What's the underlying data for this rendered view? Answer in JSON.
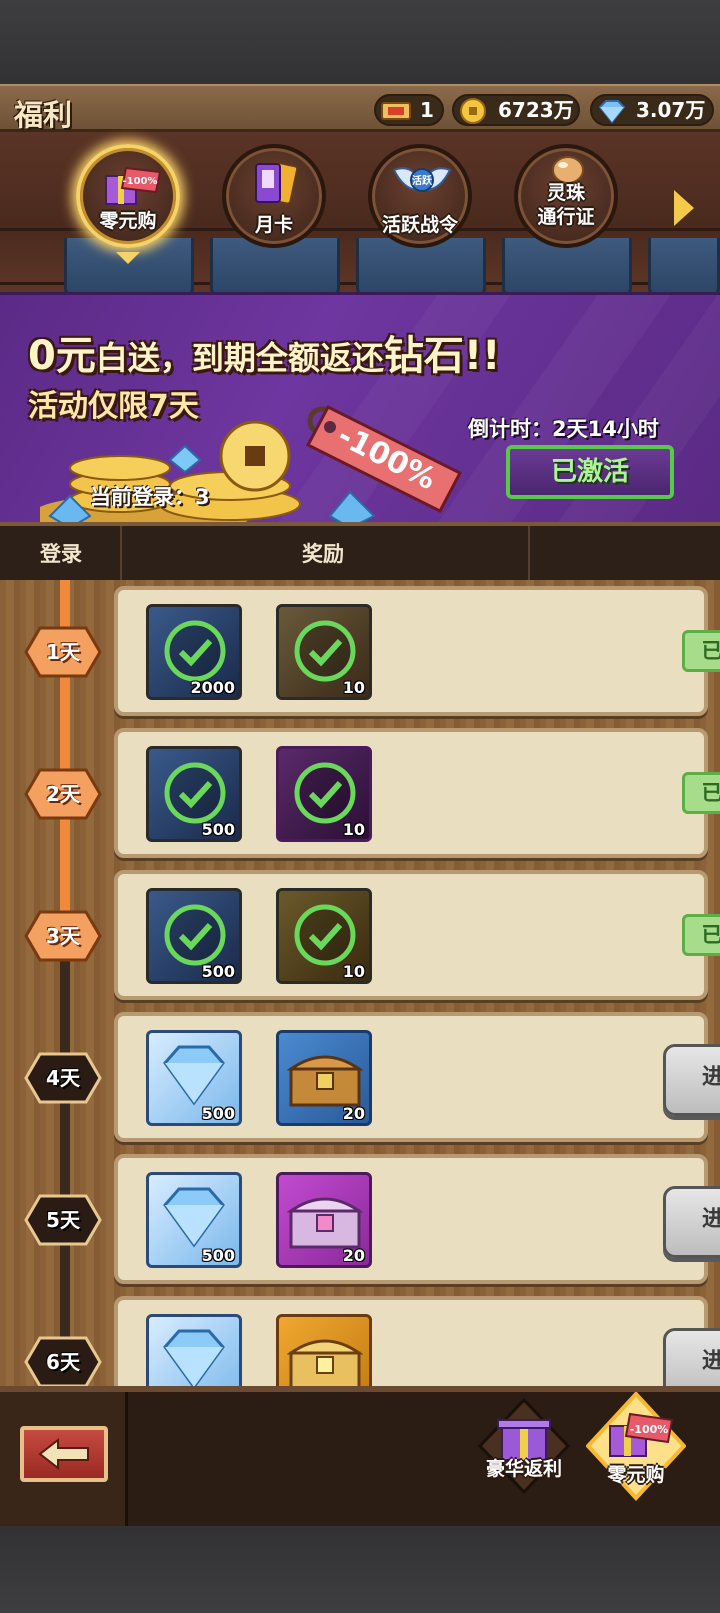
{
  "header": {
    "title": "福利",
    "resources": [
      {
        "icon": "ticket-icon",
        "value": "1"
      },
      {
        "icon": "coin-icon",
        "value": "6723万"
      },
      {
        "icon": "diamond-icon",
        "value": "3.07万"
      }
    ]
  },
  "tabs": [
    {
      "label": "零元购",
      "tag": "-100%",
      "active": true
    },
    {
      "label": "月卡",
      "active": false
    },
    {
      "label": "活跃战令",
      "badge": "活跃",
      "active": false
    },
    {
      "label_line1": "灵珠",
      "label_line2": "通行证",
      "active": false
    }
  ],
  "banner": {
    "headline_a": "0元",
    "headline_b": "白送，到期全额返还",
    "headline_c": "钻石!!",
    "subline": "活动仅限7天",
    "tag": "-100%",
    "login_label": "当前登录：",
    "login_value": "3",
    "countdown_label": "倒计时：",
    "countdown_value": "2天14小时",
    "activated_label": "已激活"
  },
  "table": {
    "col_login": "登录",
    "col_reward": "奖励"
  },
  "rows": [
    {
      "day": "1天",
      "reward1_count": "2000",
      "reward2_count": "10",
      "status": "已领取",
      "claimed": true
    },
    {
      "day": "2天",
      "reward1_count": "500",
      "reward2_count": "10",
      "status": "已领取",
      "claimed": true
    },
    {
      "day": "3天",
      "reward1_count": "500",
      "reward2_count": "10",
      "status": "已领取",
      "claimed": true
    },
    {
      "day": "4天",
      "reward1_count": "500",
      "reward2_count": "20",
      "status": "进行中",
      "claimed": false
    },
    {
      "day": "5天",
      "reward1_count": "500",
      "reward2_count": "20",
      "status": "进行中",
      "claimed": false
    },
    {
      "day": "6天",
      "reward1_count": "",
      "reward2_count": "",
      "status": "进行中",
      "claimed": false
    }
  ],
  "bottom": {
    "items": [
      {
        "label": "豪华返利"
      },
      {
        "label": "零元购",
        "tag": "-100%"
      }
    ]
  },
  "colors": {
    "banner_purple": "#6e36a0",
    "gold": "#f5c94a",
    "claimed_green": "#5eae48",
    "day_orange": "#f08a3a"
  }
}
